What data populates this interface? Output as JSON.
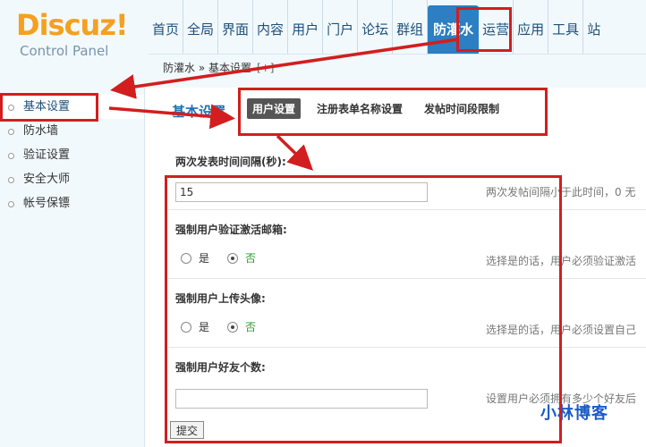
{
  "logo": {
    "main": "Discuz!",
    "sub": "Control Panel"
  },
  "nav": {
    "items": [
      {
        "label": "首页",
        "active": false
      },
      {
        "label": "全局",
        "active": false
      },
      {
        "label": "界面",
        "active": false
      },
      {
        "label": "内容",
        "active": false
      },
      {
        "label": "用户",
        "active": false
      },
      {
        "label": "门户",
        "active": false
      },
      {
        "label": "论坛",
        "active": false
      },
      {
        "label": "群组",
        "active": false
      },
      {
        "label": "防灌水",
        "active": true
      },
      {
        "label": "运营",
        "active": false
      },
      {
        "label": "应用",
        "active": false
      },
      {
        "label": "工具",
        "active": false
      },
      {
        "label": "站",
        "active": false
      }
    ]
  },
  "breadcrumb": {
    "text": "防灌水 » 基本设置",
    "add": "[+]"
  },
  "sidebar": {
    "items": [
      {
        "label": "基本设置",
        "active": true
      },
      {
        "label": "防水墙",
        "active": false
      },
      {
        "label": "验证设置",
        "active": false
      },
      {
        "label": "安全大师",
        "active": false
      },
      {
        "label": "帐号保镖",
        "active": false
      }
    ]
  },
  "main": {
    "title": "基本设置",
    "tabs": [
      {
        "label": "用户设置",
        "active": true
      },
      {
        "label": "注册表单名称设置",
        "active": false
      },
      {
        "label": "发帖时间段限制",
        "active": false
      }
    ],
    "fields": {
      "post_interval": {
        "title": "两次发表时间间隔(秒):",
        "value": "15",
        "hint": "两次发帖间隔小于此时间，0 无"
      },
      "email_verify": {
        "title": "强制用户验证激活邮箱:",
        "yes": "是",
        "no": "否",
        "selected": "no",
        "hint": "选择是的话，用户必须验证激活"
      },
      "avatar_upload": {
        "title": "强制用户上传头像:",
        "yes": "是",
        "no": "否",
        "selected": "no",
        "hint": "选择是的话，用户必须设置自己"
      },
      "friend_count": {
        "title": "强制用户好友个数:",
        "value": "",
        "hint": "设置用户必须拥有多少个好友后"
      }
    },
    "submit_label": "提交"
  },
  "watermark": "小林博客",
  "colors": {
    "accent": "#2b7fc2",
    "annotation": "#d21e1e",
    "selected_option": "#2a9a2a"
  }
}
